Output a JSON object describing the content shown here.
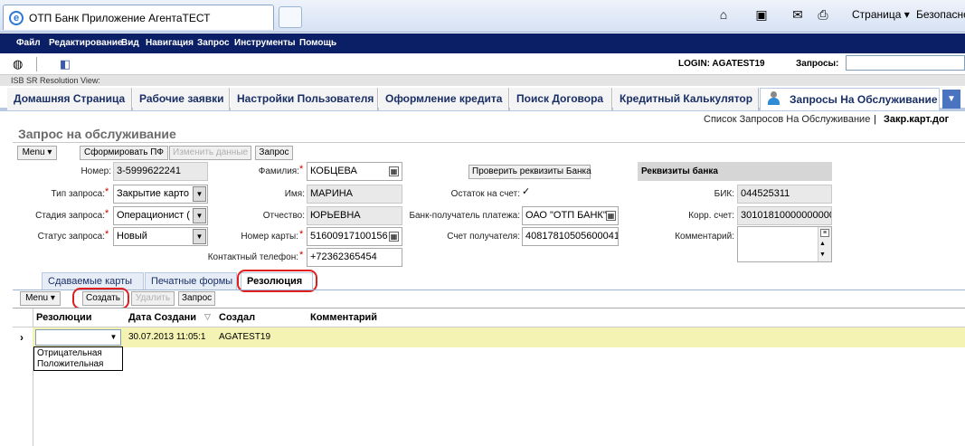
{
  "browser": {
    "tab_title": "ОТП Банк Приложение АгентаТЕСТ",
    "ie_glyph": "e",
    "commands": {
      "home": "⌂",
      "feeds": "▣",
      "read_mail": "✉",
      "print": "⎙",
      "page": "Страница ▾",
      "safety": "Безопасно"
    }
  },
  "menu": [
    "Файл",
    "Редактирование",
    "Вид",
    "Навигация",
    "Запрос",
    "Инструменты",
    "Помощь"
  ],
  "toolbar": {
    "login": "LOGIN: AGATEST19",
    "requests_label": "Запросы:",
    "globe": "◍",
    "app": "◧"
  },
  "isb": "ISB SR Resolution View:",
  "screen_tabs": [
    "Домашняя Страница",
    "Рабочие заявки",
    "Настройки Пользователя",
    "Оформление кредита",
    "Поиск Договора",
    "Кредитный Калькулятор",
    "Запросы На Обслуживание"
  ],
  "tab_more": "▼",
  "breadcrumb": {
    "list": "Список Запросов На Обслуживание",
    "sep": "|",
    "current": "Закр.карт.дог"
  },
  "form": {
    "title": "Запрос на обслуживание",
    "buttons": {
      "menu": "Menu ▾",
      "generate": "Сформировать ПФ",
      "change": "Изменить данные",
      "request": "Запрос"
    },
    "fields": {
      "number_label": "Номер:",
      "number": "3-5999622241",
      "type_label": "Тип запроса:",
      "type": "Закрытие карто",
      "stage_label": "Стадия запроса:",
      "stage": "Операционист (",
      "status_label": "Статус запроса:",
      "status": "Новый",
      "surname_label": "Фамилия:",
      "surname": "КОБЦЕВА",
      "name_label": "Имя:",
      "name": "МАРИНА",
      "patronymic_label": "Отчество:",
      "patronymic": "ЮРЬЕВНА",
      "card_label": "Номер карты:",
      "card": "51600917100156",
      "phone_label": "Контактный телефон:",
      "phone": "+72362365454",
      "check_bank": "Проверить реквизиты Банка",
      "balance_label": "Остаток на счет:",
      "balance_check": "✓",
      "payee_bank_label": "Банк-получатель платежа:",
      "payee_bank": "ОАО \"ОТП БАНК\"",
      "payee_acc_label": "Счет получателя:",
      "payee_acc": "40817810505600041",
      "bank_head": "Реквизиты банка",
      "bik_label": "БИК:",
      "bik": "044525311",
      "corr_label": "Корр. счет:",
      "corr": "30101810000000000",
      "comment_label": "Комментарий:"
    }
  },
  "bottom_tabs": [
    "Сдаваемые карты",
    "Печатные формы",
    "Резолюция"
  ],
  "grid": {
    "buttons": {
      "menu": "Menu ▾",
      "create": "Создать",
      "delete": "Удалить",
      "request": "Запрос"
    },
    "headers": {
      "resolution": "Резолюции",
      "date": "Дата Создани",
      "sort": "▽",
      "creator": "Создал",
      "comment": "Комментарий"
    },
    "row": {
      "marker": "›",
      "resolution": "",
      "date": "30.07.2013 11:05:1",
      "creator": "AGATEST19"
    },
    "options": [
      "Отрицательная",
      "Положительная"
    ]
  },
  "colors": {
    "menubar": "#0a1f66",
    "highlight": "#e01e1e",
    "row_selected": "#f5f3b4"
  }
}
